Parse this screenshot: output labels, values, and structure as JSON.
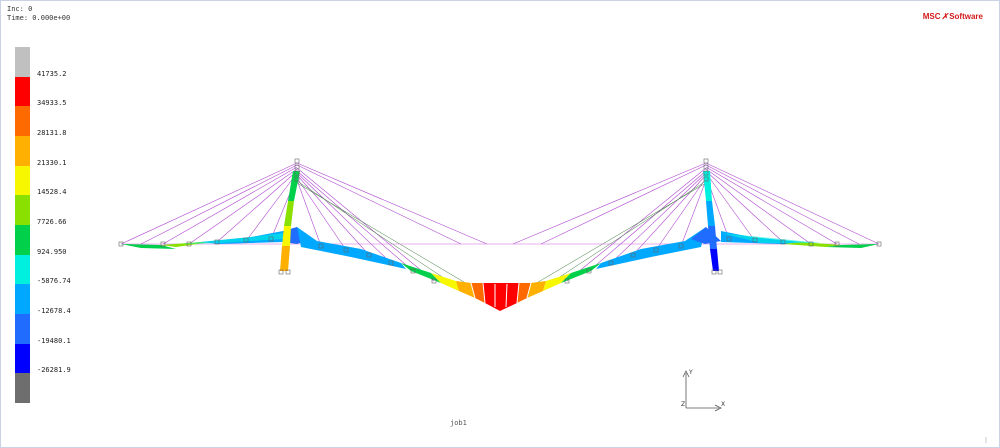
{
  "header": {
    "inc_label": "Inc:",
    "inc_value": "0",
    "time_label": "Time:",
    "time_value": "0.000e+00"
  },
  "logo": {
    "brand_left": "MSC",
    "brand_right": "Software"
  },
  "legend": {
    "entries": [
      {
        "label": "41735.2",
        "color": "#c0c0c0"
      },
      {
        "label": "34933.5",
        "color": "#ff0000"
      },
      {
        "label": "28131.8",
        "color": "#ff6a00"
      },
      {
        "label": "21330.1",
        "color": "#ffb000"
      },
      {
        "label": "14528.4",
        "color": "#f7f700"
      },
      {
        "label": "7726.66",
        "color": "#8ae000"
      },
      {
        "label": "924.950",
        "color": "#00d04a"
      },
      {
        "label": "-5876.74",
        "color": "#00f0e0"
      },
      {
        "label": "-12678.4",
        "color": "#00a8ff"
      },
      {
        "label": "-19480.1",
        "color": "#1f6cff"
      },
      {
        "label": "-26281.9",
        "color": "#0000ff"
      },
      {
        "label": "",
        "color": "#6e6e6e"
      }
    ]
  },
  "axes": {
    "x": "X",
    "y": "Y",
    "z": "Z"
  },
  "job": {
    "name": "job1"
  },
  "corner_mark": "|"
}
